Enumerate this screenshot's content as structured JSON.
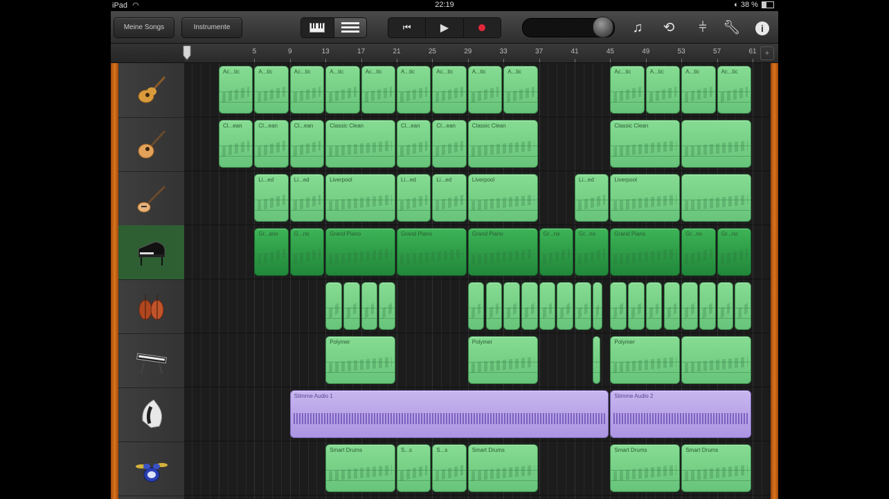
{
  "status_bar": {
    "device": "iPad",
    "wifi_icon": "wifi-icon",
    "time": "22:19",
    "battery": "38 %"
  },
  "toolbar": {
    "my_songs_label": "Meine Songs",
    "instruments_label": "Instrumente",
    "view_icons": [
      "keyboard-view-icon",
      "tracks-view-icon"
    ],
    "transport_icons": [
      "rewind-icon",
      "play-icon",
      "record-icon"
    ],
    "right_icons": [
      "note-settings-icon",
      "loop-browser-icon",
      "mixer-icon",
      "wrench-icon",
      "help-icon"
    ]
  },
  "ruler": {
    "ticks": [
      "5",
      "9",
      "13",
      "17",
      "21",
      "25",
      "29",
      "33",
      "37",
      "41",
      "45",
      "49",
      "53",
      "57",
      "61"
    ]
  },
  "tracks": [
    {
      "name": "track-acoustic-guitar",
      "icon": "acoustic-guitar-icon"
    },
    {
      "name": "track-electric-guitar",
      "icon": "electric-guitar-icon"
    },
    {
      "name": "track-bass",
      "icon": "bass-guitar-icon"
    },
    {
      "name": "track-grand-piano",
      "icon": "grand-piano-icon",
      "selected": true
    },
    {
      "name": "track-strings",
      "icon": "strings-icon"
    },
    {
      "name": "track-keyboard",
      "icon": "keyboard-instrument-icon"
    },
    {
      "name": "track-audio-recorder",
      "icon": "microphone-icon"
    },
    {
      "name": "track-drums",
      "icon": "drum-kit-icon"
    }
  ],
  "regions": [
    [
      {
        "start": 1,
        "len": 4,
        "label": "Ac...tic"
      },
      {
        "start": 5,
        "len": 4,
        "label": "A...tic"
      },
      {
        "start": 9,
        "len": 4,
        "label": "Ac...tic"
      },
      {
        "start": 13,
        "len": 4,
        "label": "A...tic"
      },
      {
        "start": 17,
        "len": 4,
        "label": "Ac...tic"
      },
      {
        "start": 21,
        "len": 4,
        "label": "A...tic"
      },
      {
        "start": 25,
        "len": 4,
        "label": "Ac...tic"
      },
      {
        "start": 29,
        "len": 4,
        "label": "A...tic"
      },
      {
        "start": 33,
        "len": 4,
        "label": "A...tic"
      },
      {
        "start": 45,
        "len": 4,
        "label": "Ac...tic"
      },
      {
        "start": 49,
        "len": 4,
        "label": "A...tic"
      },
      {
        "start": 53,
        "len": 4,
        "label": "A...tic"
      },
      {
        "start": 57,
        "len": 4,
        "label": "Ac...tic"
      }
    ],
    [
      {
        "start": 1,
        "len": 4,
        "label": "Cl...ean"
      },
      {
        "start": 5,
        "len": 4,
        "label": "Cl...ean"
      },
      {
        "start": 9,
        "len": 4,
        "label": "Cl...ean"
      },
      {
        "start": 13,
        "len": 8,
        "label": "Classic Clean"
      },
      {
        "start": 21,
        "len": 4,
        "label": "Cl...ean"
      },
      {
        "start": 25,
        "len": 4,
        "label": "Cl...ean"
      },
      {
        "start": 29,
        "len": 8,
        "label": "Classic Clean"
      },
      {
        "start": 45,
        "len": 8,
        "label": "Classic Clean"
      },
      {
        "start": 53,
        "len": 8,
        "label": ""
      }
    ],
    [
      {
        "start": 5,
        "len": 4,
        "label": "Li...ed"
      },
      {
        "start": 9,
        "len": 4,
        "label": "Li...ed"
      },
      {
        "start": 13,
        "len": 8,
        "label": "Liverpool"
      },
      {
        "start": 21,
        "len": 4,
        "label": "Li...ed"
      },
      {
        "start": 25,
        "len": 4,
        "label": "Li...ed"
      },
      {
        "start": 29,
        "len": 8,
        "label": "Liverpool"
      },
      {
        "start": 41,
        "len": 4,
        "label": "Li...ed"
      },
      {
        "start": 45,
        "len": 8,
        "label": "Liverpool"
      },
      {
        "start": 53,
        "len": 8,
        "label": ""
      }
    ],
    [
      {
        "start": 5,
        "len": 4,
        "label": "Gr...ano"
      },
      {
        "start": 9,
        "len": 4,
        "label": "G...no"
      },
      {
        "start": 13,
        "len": 8,
        "label": "Grand Piano"
      },
      {
        "start": 21,
        "len": 8,
        "label": "Grand Piano"
      },
      {
        "start": 29,
        "len": 8,
        "label": "Grand Piano"
      },
      {
        "start": 37,
        "len": 4,
        "label": "Gr...no"
      },
      {
        "start": 41,
        "len": 4,
        "label": "Gr...no"
      },
      {
        "start": 45,
        "len": 8,
        "label": "Grand Piano"
      },
      {
        "start": 53,
        "len": 4,
        "label": "Gr...no"
      },
      {
        "start": 57,
        "len": 4,
        "label": "Gr...no"
      }
    ],
    [
      {
        "start": 13,
        "len": 2,
        "label": ""
      },
      {
        "start": 15,
        "len": 2,
        "label": ""
      },
      {
        "start": 17,
        "len": 2,
        "label": ""
      },
      {
        "start": 19,
        "len": 2,
        "label": ""
      },
      {
        "start": 29,
        "len": 2,
        "label": ""
      },
      {
        "start": 31,
        "len": 2,
        "label": ""
      },
      {
        "start": 33,
        "len": 2,
        "label": ""
      },
      {
        "start": 35,
        "len": 2,
        "label": ""
      },
      {
        "start": 37,
        "len": 2,
        "label": ""
      },
      {
        "start": 39,
        "len": 2,
        "label": ""
      },
      {
        "start": 41,
        "len": 2,
        "label": ""
      },
      {
        "start": 43,
        "len": 1.3,
        "label": ""
      },
      {
        "start": 45,
        "len": 2,
        "label": ""
      },
      {
        "start": 47,
        "len": 2,
        "label": ""
      },
      {
        "start": 49,
        "len": 2,
        "label": ""
      },
      {
        "start": 51,
        "len": 2,
        "label": ""
      },
      {
        "start": 53,
        "len": 2,
        "label": ""
      },
      {
        "start": 55,
        "len": 2,
        "label": ""
      },
      {
        "start": 57,
        "len": 2,
        "label": ""
      },
      {
        "start": 59,
        "len": 2,
        "label": ""
      }
    ],
    [
      {
        "start": 13,
        "len": 8,
        "label": "Polymer"
      },
      {
        "start": 29,
        "len": 8,
        "label": "Polymer"
      },
      {
        "start": 43,
        "len": 1,
        "label": ""
      },
      {
        "start": 45,
        "len": 8,
        "label": "Polymer"
      },
      {
        "start": 53,
        "len": 8,
        "label": ""
      }
    ],
    [
      {
        "start": 9,
        "len": 36,
        "label": "Stimme Audio 1",
        "audio": true
      },
      {
        "start": 45,
        "len": 16,
        "label": "Stimme Audio 2",
        "audio": true
      }
    ],
    [
      {
        "start": 13,
        "len": 8,
        "label": "Smart Drums"
      },
      {
        "start": 21,
        "len": 4,
        "label": "S...s"
      },
      {
        "start": 25,
        "len": 4,
        "label": "S...s"
      },
      {
        "start": 29,
        "len": 8,
        "label": "Smart Drums"
      },
      {
        "start": 45,
        "len": 8,
        "label": "Smart Drums"
      },
      {
        "start": 53,
        "len": 8,
        "label": "Smart Drums"
      }
    ]
  ]
}
